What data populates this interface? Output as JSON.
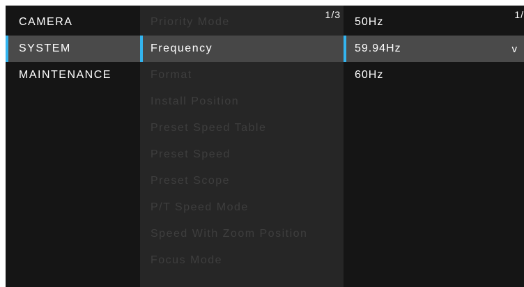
{
  "left_menu": {
    "items": [
      {
        "label": "CAMERA"
      },
      {
        "label": "SYSTEM"
      },
      {
        "label": "MAINTENANCE"
      }
    ]
  },
  "middle_menu": {
    "page": "1/3",
    "items": [
      {
        "label": "Priority Mode"
      },
      {
        "label": "Frequency"
      },
      {
        "label": "Format"
      },
      {
        "label": "Install Position"
      },
      {
        "label": "Preset Speed Table"
      },
      {
        "label": "Preset Speed"
      },
      {
        "label": "Preset Scope"
      },
      {
        "label": "P/T Speed Mode"
      },
      {
        "label": "Speed With Zoom Position"
      },
      {
        "label": "Focus Mode"
      }
    ]
  },
  "right_menu": {
    "page": "1/",
    "selected_indicator": "v",
    "options": [
      {
        "label": "50Hz"
      },
      {
        "label": "59.94Hz"
      },
      {
        "label": "60Hz"
      }
    ]
  },
  "colors": {
    "accent": "#33b4ef",
    "background": "#151515",
    "middle_panel": "#262626",
    "selected_row": "#4a4a4a",
    "dim_text": "#3e3e3e"
  }
}
